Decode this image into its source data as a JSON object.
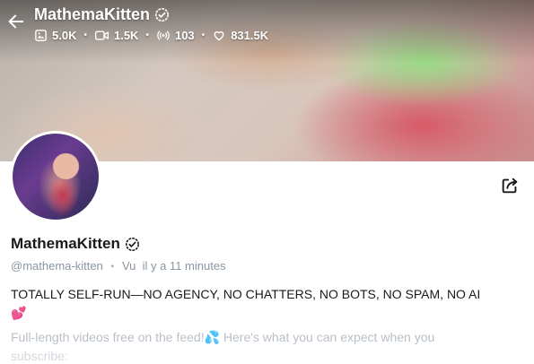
{
  "header": {
    "title": "MathemaKitten",
    "stats": [
      {
        "icon": "image-icon",
        "value": "5.0K"
      },
      {
        "icon": "video-icon",
        "value": "1.5K"
      },
      {
        "icon": "broadcast-icon",
        "value": "103"
      },
      {
        "icon": "heart-icon",
        "value": "831.5K"
      }
    ]
  },
  "profile": {
    "name": "MathemaKitten",
    "handle": "@mathema-kitten",
    "separator": "•",
    "last_seen": "Vu  il y a 11 minutes"
  },
  "bio": {
    "line1": "TOTALLY SELF-RUN—NO AGENCY, NO CHATTERS, NO BOTS, NO SPAM, NO AI",
    "line1_emoji": "💕",
    "line2": "Full-length videos free on the feed!💦 Here's what you can expect when you",
    "line3": "subscribe:"
  },
  "colors": {
    "verified": "#1a1a1a",
    "muted": "#8a96a3"
  }
}
